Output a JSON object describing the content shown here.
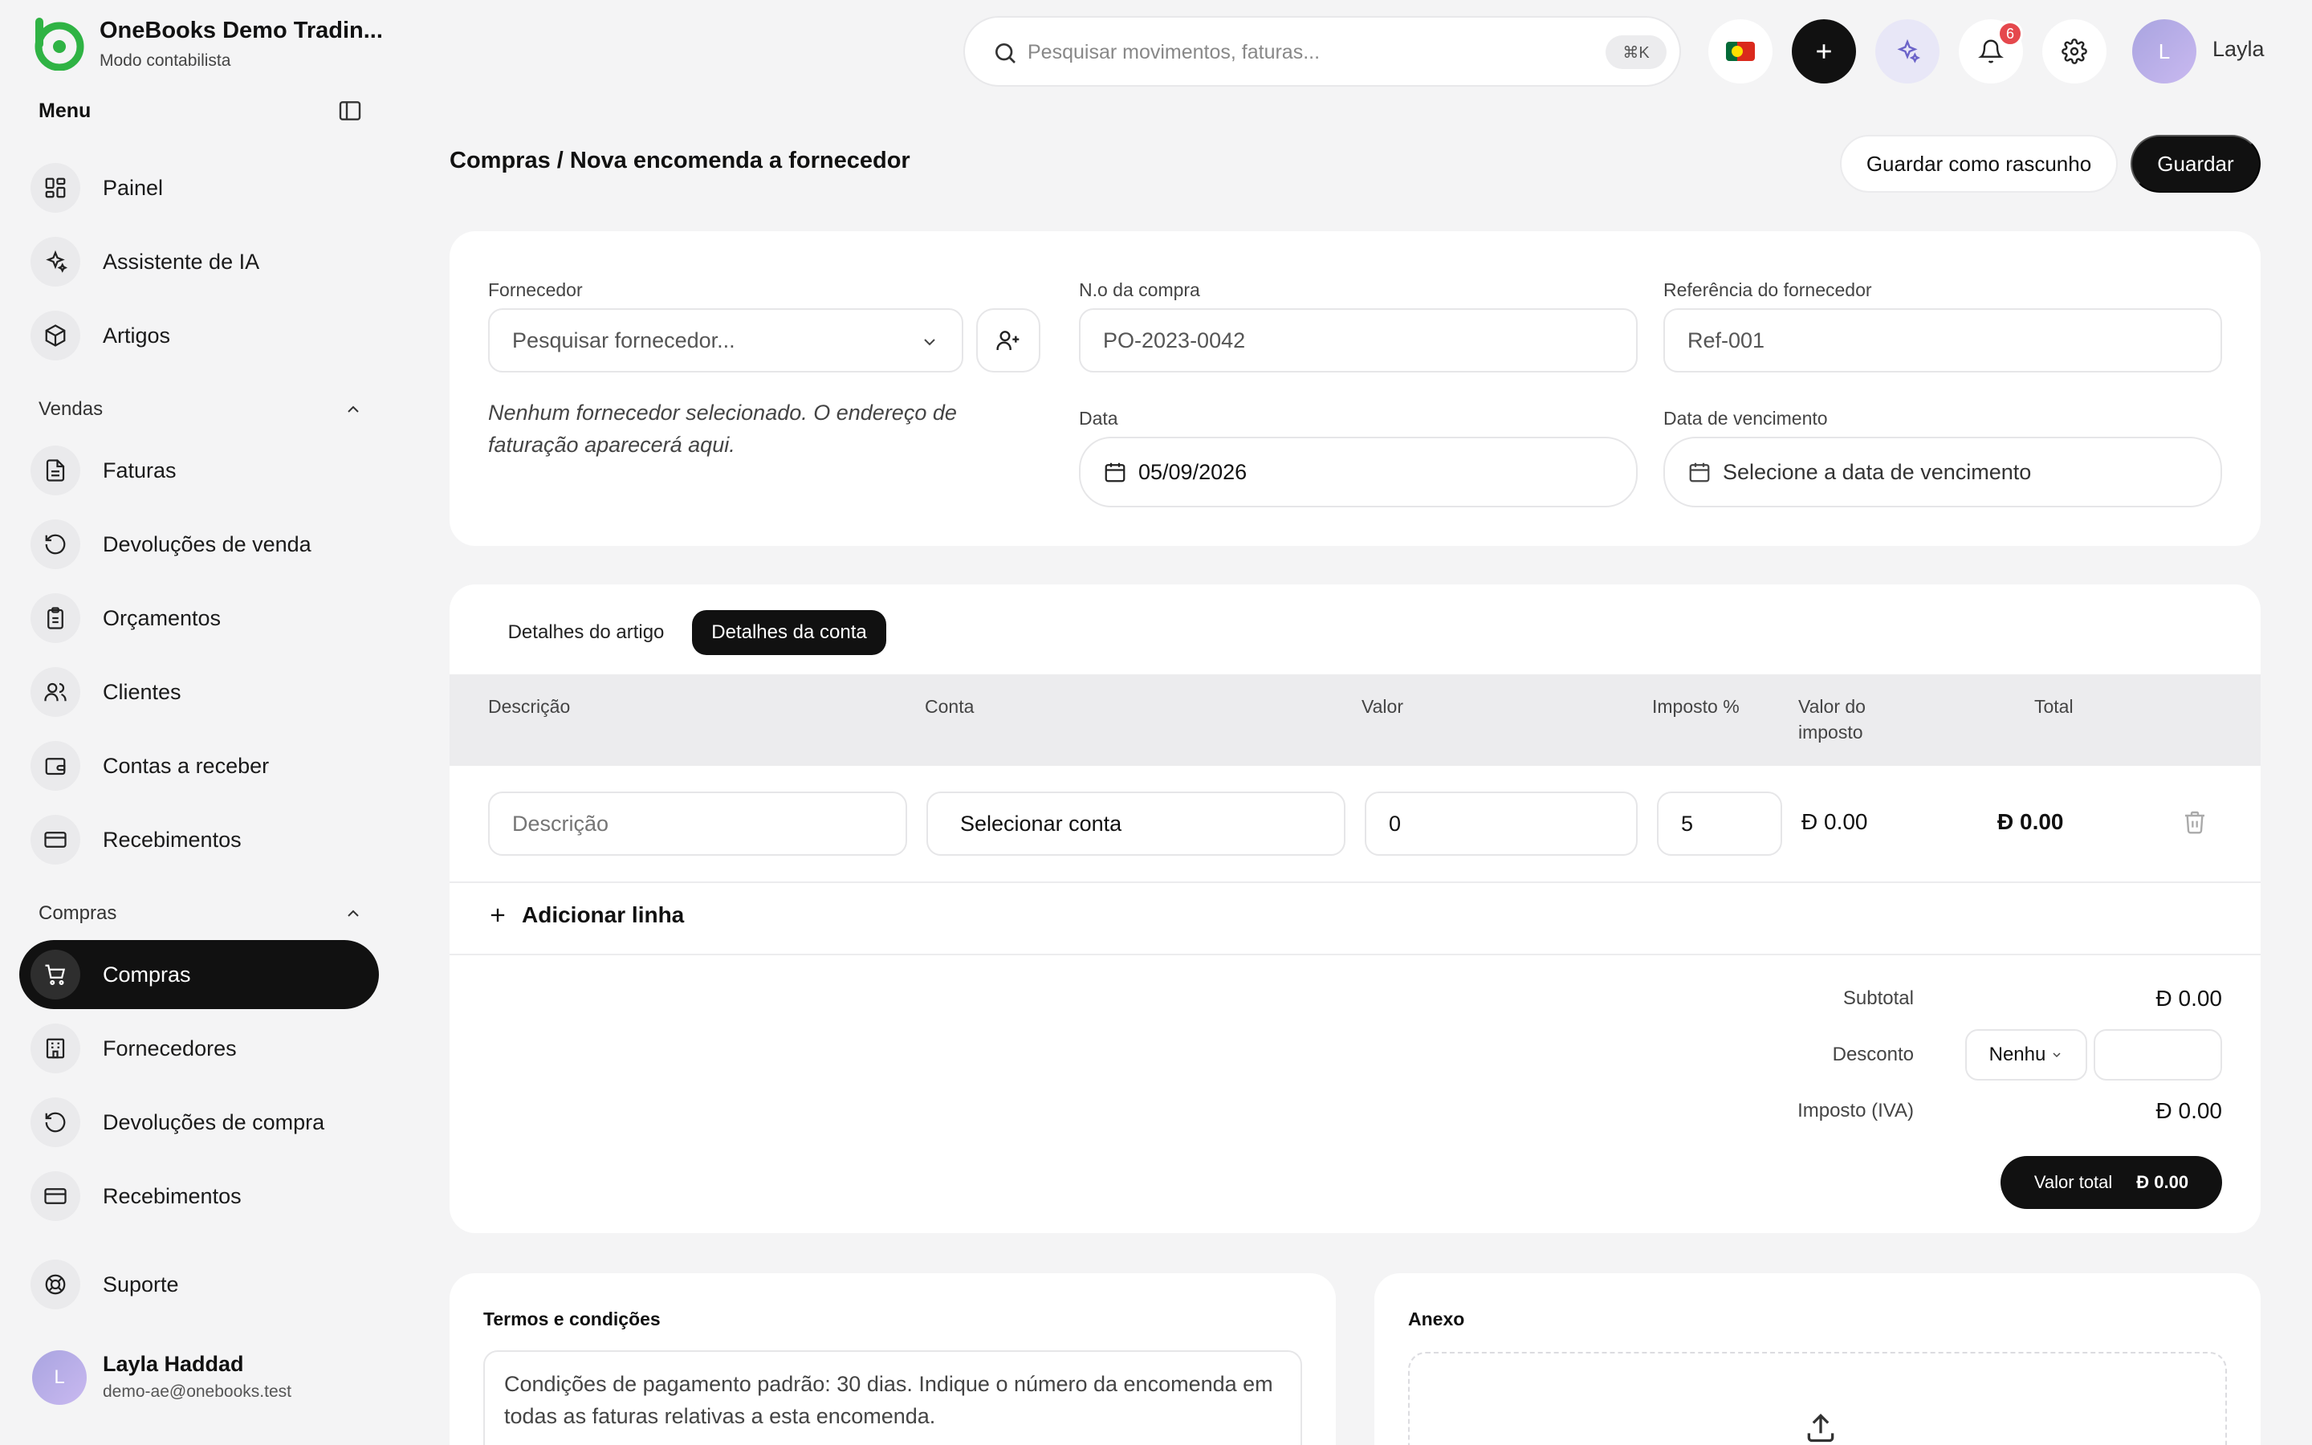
{
  "brand": {
    "name": "OneBooks Demo Tradin...",
    "mode": "Modo contabilista"
  },
  "sidebar": {
    "menu_title": "Menu",
    "main_items": [
      {
        "label": "Painel",
        "icon": "dashboard-icon"
      },
      {
        "label": "Assistente de IA",
        "icon": "sparkles-icon"
      },
      {
        "label": "Artigos",
        "icon": "box-icon"
      }
    ],
    "sales": {
      "title": "Vendas",
      "items": [
        {
          "label": "Faturas",
          "icon": "file-text-icon"
        },
        {
          "label": "Devoluções de venda",
          "icon": "rotate-ccw-icon"
        },
        {
          "label": "Orçamentos",
          "icon": "clipboard-icon"
        },
        {
          "label": "Clientes",
          "icon": "users-icon"
        },
        {
          "label": "Contas a receber",
          "icon": "wallet-icon"
        },
        {
          "label": "Recebimentos",
          "icon": "credit-card-icon"
        }
      ]
    },
    "purchases": {
      "title": "Compras",
      "items": [
        {
          "label": "Compras",
          "icon": "shopping-cart-icon",
          "active": true
        },
        {
          "label": "Fornecedores",
          "icon": "building-icon"
        },
        {
          "label": "Devoluções de compra",
          "icon": "rotate-ccw-icon"
        },
        {
          "label": "Recebimentos",
          "icon": "credit-card-icon"
        }
      ]
    },
    "support": {
      "label": "Suporte",
      "icon": "life-buoy-icon"
    },
    "user": {
      "initial": "L",
      "name": "Layla Haddad",
      "email": "demo-ae@onebooks.test"
    }
  },
  "topbar": {
    "search_placeholder": "Pesquisar movimentos, faturas...",
    "shortcut": "⌘K",
    "notifications_count": "6",
    "user_initial": "L",
    "user_name": "Layla"
  },
  "header": {
    "breadcrumb": "Compras / Nova encomenda a fornecedor",
    "draft_label": "Guardar como rascunho",
    "save_label": "Guardar"
  },
  "form": {
    "supplier_label": "Fornecedor",
    "supplier_placeholder": "Pesquisar fornecedor...",
    "supplier_note": "Nenhum fornecedor selecionado. O endereço de faturação aparecerá aqui.",
    "po_label": "N.o da compra",
    "po_value": "PO-2023-0042",
    "ref_label": "Referência do fornecedor",
    "ref_value": "Ref-001",
    "date_label": "Data",
    "date_value": "05/09/2026",
    "due_label": "Data de vencimento",
    "due_placeholder": "Selecione a data de vencimento"
  },
  "tabs": [
    "Detalhes do artigo",
    "Detalhes da conta"
  ],
  "table": {
    "headers": [
      "Descrição",
      "Conta",
      "Valor",
      "Imposto %",
      "Valor do imposto",
      "Total"
    ],
    "row": {
      "description_placeholder": "Descrição",
      "account": "Selecionar conta",
      "value": "0",
      "tax_percent": "5",
      "tax_value": "Đ 0.00",
      "total": "Đ 0.00"
    },
    "add_line": "Adicionar linha"
  },
  "summary": {
    "subtotal_label": "Subtotal",
    "subtotal": "Đ 0.00",
    "discount_label": "Desconto",
    "discount_option": "Nenhu",
    "tax_label": "Imposto (IVA)",
    "tax": "Đ 0.00",
    "total_label": "Valor total",
    "total": "Đ 0.00"
  },
  "terms": {
    "title": "Termos e condições",
    "text": "Condições de pagamento padrão: 30 dias. Indique o número da encomenda em todas as faturas relativas a esta encomenda."
  },
  "attachment": {
    "title": "Anexo"
  },
  "colors": {
    "accent": "#111111",
    "brand_green": "#2fb344",
    "badge": "#e5484d",
    "background": "#f4f4f5"
  }
}
